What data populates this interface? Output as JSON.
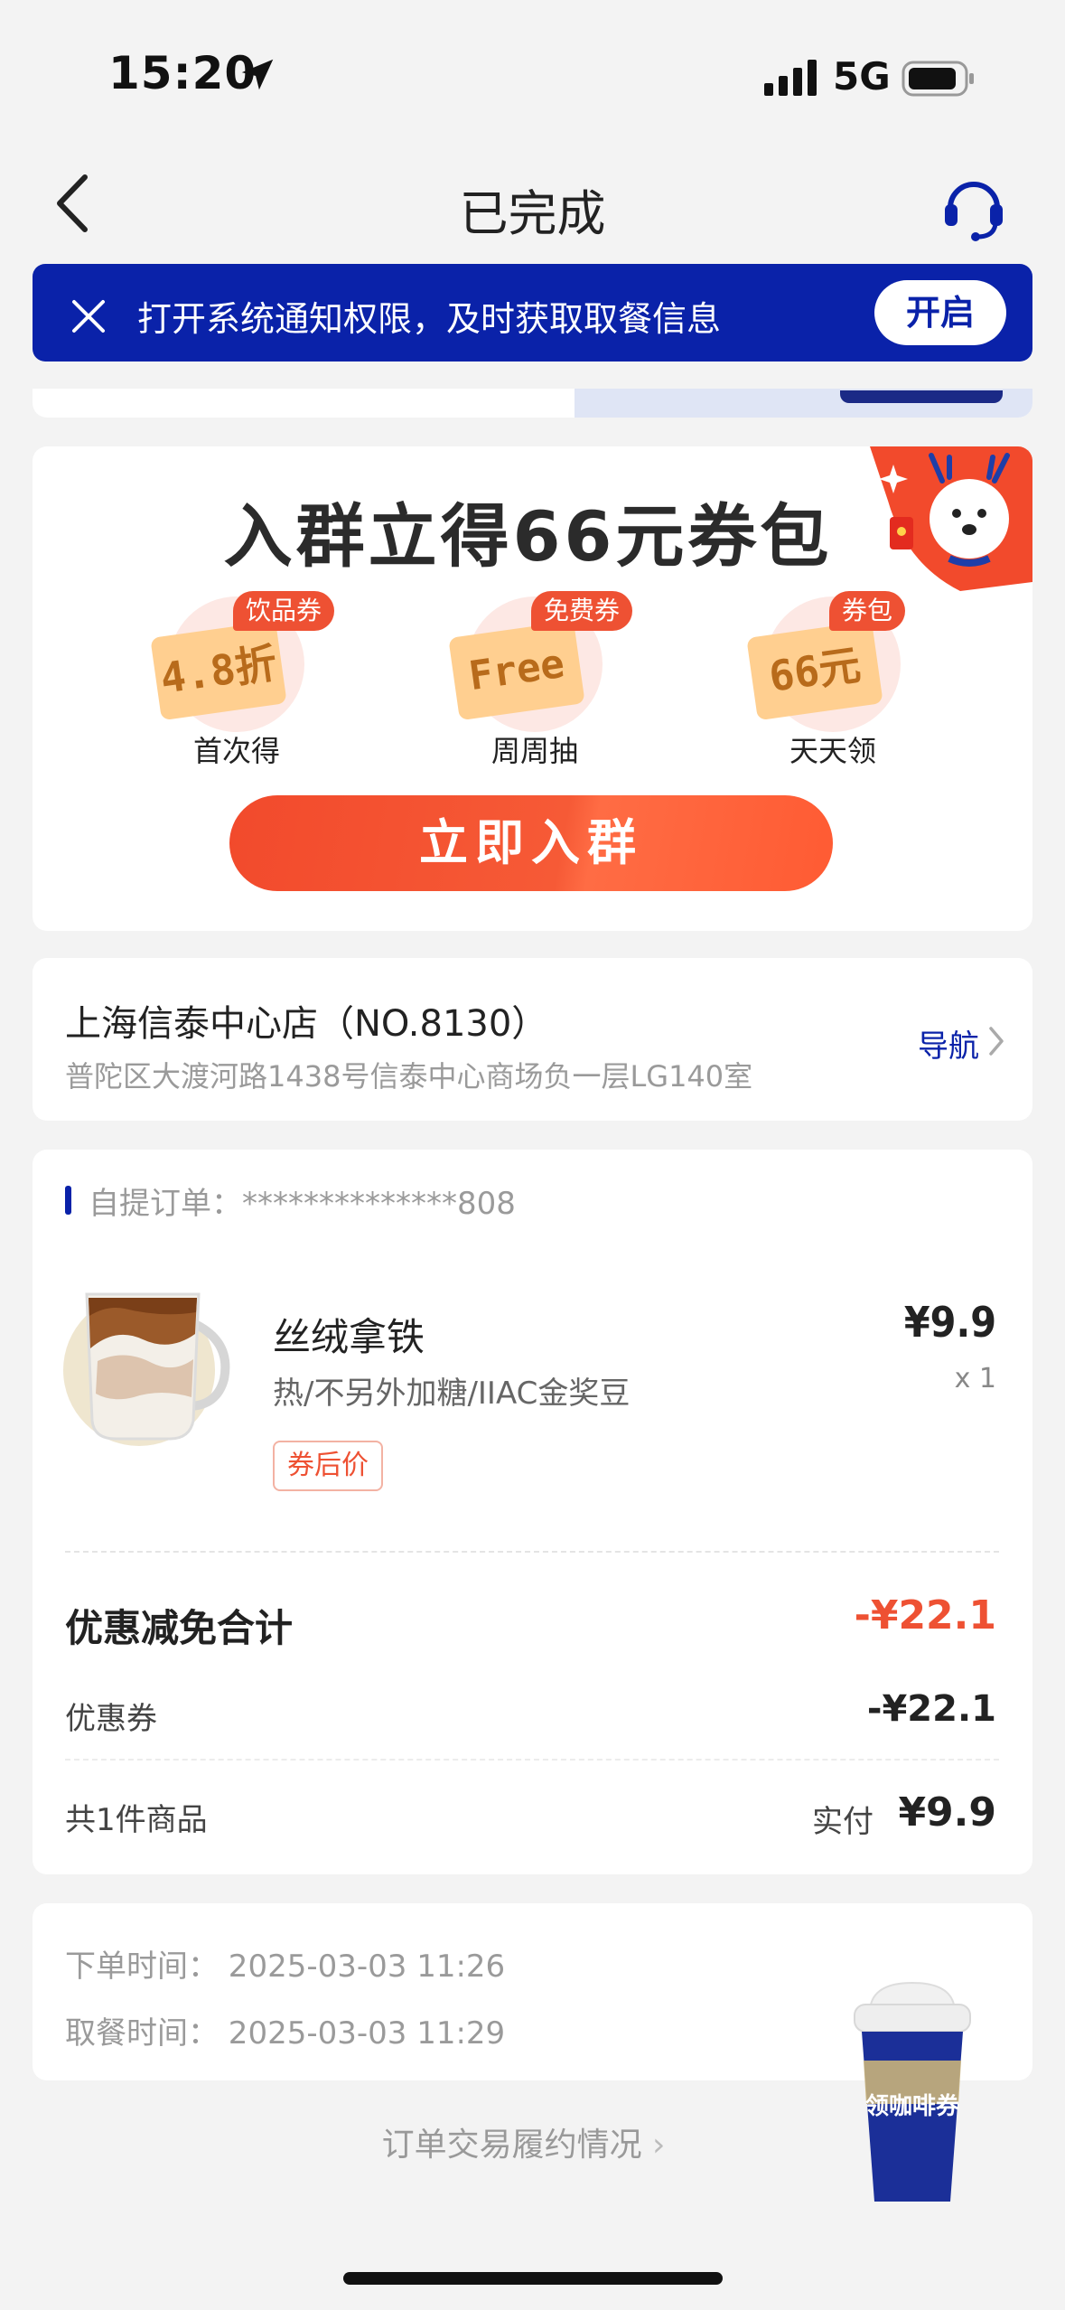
{
  "status_bar": {
    "time": "15:20",
    "network": "5G"
  },
  "header": {
    "title": "已完成"
  },
  "notice": {
    "text": "打开系统通知权限，及时获取取餐信息",
    "button": "开启"
  },
  "group_promo": {
    "title": "入群立得66元券包",
    "coupons": [
      {
        "badge": "饮品券",
        "value": "4.8折",
        "label": "首次得"
      },
      {
        "badge": "免费券",
        "value": "Free",
        "label": "周周抽"
      },
      {
        "badge": "券包",
        "value": "66元",
        "label": "天天领"
      }
    ],
    "button": "立即入群"
  },
  "store": {
    "name": "上海信泰中心店（NO.8130）",
    "address": "普陀区大渡河路1438号信泰中心商场负一层LG140室",
    "nav_label": "导航"
  },
  "order": {
    "label": "自提订单：",
    "number": "**************808",
    "item": {
      "name": "丝绒拿铁",
      "spec": "热/不另外加糖/IIAC金奖豆",
      "tag": "券后价",
      "price": "¥9.9",
      "qty": "x 1"
    },
    "discount_label": "优惠减免合计",
    "discount_total": "-¥22.1",
    "coupon_label": "优惠券",
    "coupon_value": "-¥22.1",
    "count_label": "共1件商品",
    "pay_label": "实付",
    "pay_value": "¥9.9"
  },
  "times": {
    "order_time": "下单时间：  2025-03-03 11:26",
    "pickup_time": "取餐时间：  2025-03-03 11:29"
  },
  "footer": {
    "fulfill_link": "订单交易履约情况"
  },
  "floating": {
    "cup_text": "领咖啡券"
  },
  "colors": {
    "brand_blue": "#0a22a9",
    "accent_red": "#ee5133",
    "background": "#f3f3f3"
  }
}
